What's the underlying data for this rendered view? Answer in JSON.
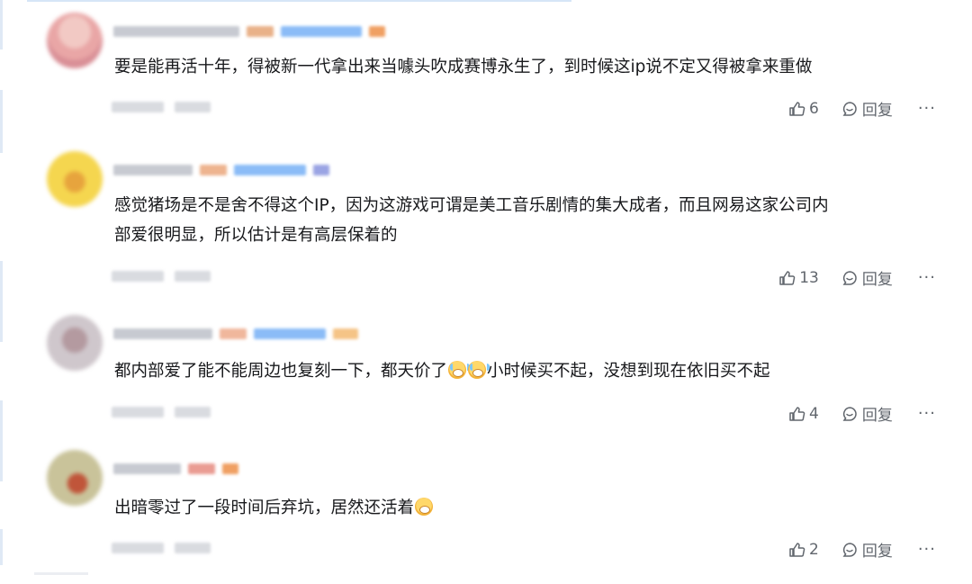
{
  "comments": [
    {
      "text": "要是能再活十年，得被新一代拿出来当噱头吹成赛博永生了，到时候这ip说不定又得被拿来重做",
      "likes": "6",
      "reply_label": "回复",
      "more_label": "···"
    },
    {
      "text_line1": "感觉猪场是不是舍不得这个IP，因为这游戏可谓是美工音乐剧情的集大成者，而且网易这家公司内",
      "text_line2": "部爱很明显，所以估计是有高层保着的",
      "likes": "13",
      "reply_label": "回复",
      "more_label": "···"
    },
    {
      "text_before": "都内部爱了能不能周边也复刻一下，都天价了",
      "text_after": "小时候买不起，没想到现在依旧买不起",
      "emoji": "crying-laughing-emoji",
      "likes": "4",
      "reply_label": "回复",
      "more_label": "···"
    },
    {
      "text": "出暗零过了一段时间后弃坑，居然还活着",
      "emoji": "laughing-emoji",
      "likes": "2",
      "reply_label": "回复",
      "more_label": "···"
    }
  ],
  "colors": {
    "text": "#18191c",
    "meta": "#61666d",
    "blur_name": "#c8ccd3",
    "blur_badge_blue": "#7fb6ff",
    "blur_badge_orange": "#f1a16f"
  },
  "icons": {
    "like": "thumbs-up-icon",
    "reply": "reply-bubble-icon",
    "more": "more-dots-icon"
  }
}
